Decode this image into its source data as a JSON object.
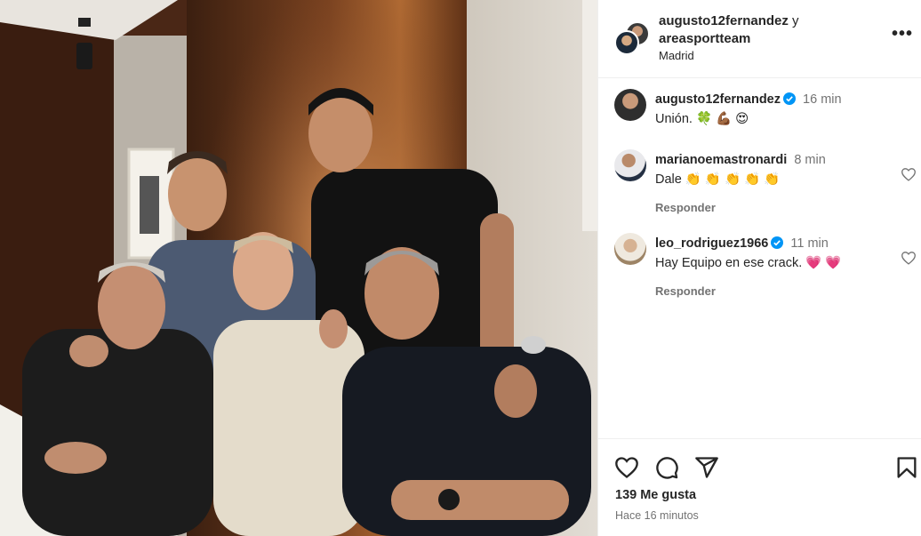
{
  "header": {
    "author1": "augusto12fernandez",
    "joiner": "y",
    "author2": "areasportteam",
    "location": "Madrid",
    "more_label": "•••"
  },
  "comments": [
    {
      "user": "augusto12fernandez",
      "verified": true,
      "time": "16 min",
      "text": "Unión. 🍀 💪🏾 😍",
      "reply_label": ""
    },
    {
      "user": "marianoemastronardi",
      "verified": false,
      "time": "8 min",
      "text": "Dale 👏 👏 👏 👏 👏",
      "reply_label": "Responder"
    },
    {
      "user": "leo_rodriguez1966",
      "verified": true,
      "time": "11 min",
      "text": "Hay Equipo en ese crack. 💗 💗",
      "reply_label": "Responder"
    }
  ],
  "footer": {
    "likes": "139 Me gusta",
    "time_ago": "Hace 16 minutos"
  },
  "icons": {
    "like": "heart-icon",
    "comment": "comment-icon",
    "share": "share-icon",
    "save": "bookmark-icon"
  },
  "colors": {
    "verified": "#0095f6",
    "muted": "#737373",
    "text": "#262626"
  }
}
